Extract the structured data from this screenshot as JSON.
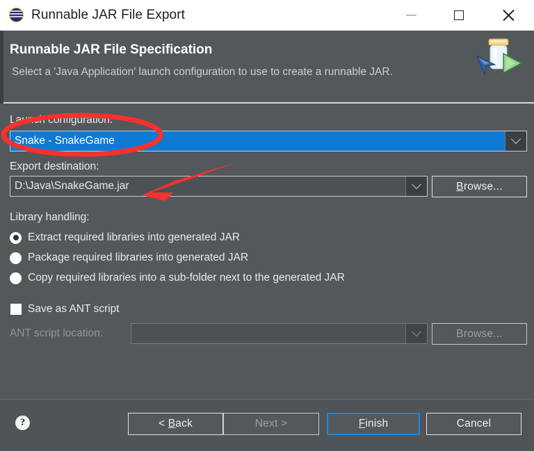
{
  "window": {
    "title": "Runnable JAR File Export",
    "app_icon": "eclipse-globe-icon",
    "controls": {
      "minimize": "minimize-icon",
      "maximize": "maximize-icon",
      "close": "close-icon"
    }
  },
  "header": {
    "title": "Runnable JAR File Specification",
    "description": "Select a 'Java Application' launch configuration to use to create a runnable JAR.",
    "icon": "runnable-jar-icon"
  },
  "form": {
    "launch_configuration": {
      "label": "Launch configuration:",
      "value": "Snake - SnakeGame",
      "arrow_icon": "chevron-down-icon"
    },
    "export_destination": {
      "label": "Export destination:",
      "value": "D:\\Java\\SnakeGame.jar",
      "placeholder": "",
      "arrow_icon": "chevron-down-icon",
      "browse_label": "Browse...",
      "browse_mnemonic": "B"
    },
    "library_handling": {
      "label": "Library handling:",
      "options": [
        {
          "label": "Extract required libraries into generated JAR",
          "mnemonic": "E",
          "checked": true
        },
        {
          "label": "Package required libraries into generated JAR",
          "mnemonic": "P",
          "checked": false
        },
        {
          "label": "Copy required libraries into a sub-folder next to the generated JAR",
          "mnemonic": "C",
          "checked": false
        }
      ]
    },
    "save_as_ant": {
      "label": "Save as ANT script",
      "mnemonic": "S",
      "checked": false
    },
    "ant_script_location": {
      "label": "ANT script location:",
      "value": "",
      "disabled": true,
      "arrow_icon": "chevron-down-icon",
      "browse_label": "Browse...",
      "disabled_browse": true
    }
  },
  "footer": {
    "help_icon": "help-icon",
    "buttons": [
      {
        "name": "back",
        "label": "< Back",
        "mnemonic": "B",
        "disabled": false,
        "default": false
      },
      {
        "name": "next",
        "label": "Next >",
        "mnemonic": "N",
        "disabled": true,
        "default": false
      },
      {
        "name": "finish",
        "label": "Finish",
        "mnemonic": "F",
        "disabled": false,
        "default": true
      },
      {
        "name": "cancel",
        "label": "Cancel",
        "mnemonic": "C",
        "disabled": false,
        "default": false
      }
    ]
  },
  "annotations": {
    "color": "#f7312e",
    "ellipse_target": "launch-configuration-combo",
    "arrow_target": "export-destination-field"
  },
  "colors": {
    "dialog_background": "#53585b",
    "titlebar_background": "#ffffff",
    "selection_blue": "#0f7ad4",
    "focus_blue": "#1b88e0",
    "annotation_red": "#f7312e"
  }
}
